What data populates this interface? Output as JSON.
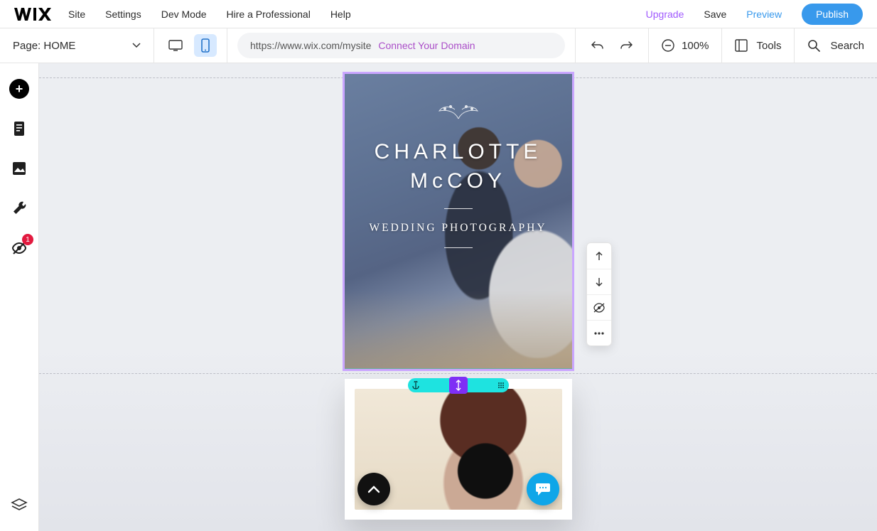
{
  "topbar": {
    "menus": [
      "Site",
      "Settings",
      "Dev Mode",
      "Hire a Professional",
      "Help"
    ],
    "upgrade": "Upgrade",
    "save": "Save",
    "preview": "Preview",
    "publish": "Publish"
  },
  "toolbar": {
    "page_prefix": "Page:",
    "page_name": "HOME",
    "url": "https://www.wix.com/mysite",
    "connect_domain": "Connect Your Domain",
    "zoom": "100%",
    "tools": "Tools",
    "search": "Search"
  },
  "left_rail": {
    "badge_count": "1"
  },
  "canvas": {
    "hero_title_line1": "CHARLOTTE",
    "hero_title_line2": "McCOY",
    "hero_subtitle": "WEDDING PHOTOGRAPHY"
  }
}
